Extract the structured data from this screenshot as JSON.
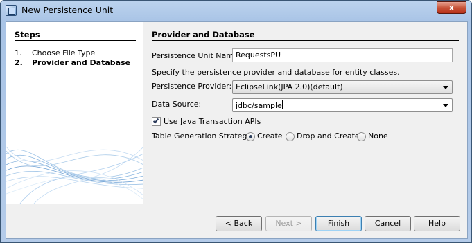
{
  "window": {
    "title": "New Persistence Unit",
    "close_glyph": "x"
  },
  "steps": {
    "title": "Steps",
    "items": [
      {
        "num": "1.",
        "label": "Choose File Type",
        "active": false
      },
      {
        "num": "2.",
        "label": "Provider and Database",
        "active": true
      }
    ]
  },
  "main": {
    "title": "Provider and Database",
    "unit_name_label": "Persistence Unit Name:",
    "unit_name_value": "RequestsPU",
    "description": "Specify the persistence provider and database for entity classes.",
    "provider_label": "Persistence Provider:",
    "provider_value": "EclipseLink(JPA 2.0)(default)",
    "datasource_label": "Data Source:",
    "datasource_value": "jdbc/sample",
    "jta_label": "Use Java Transaction APIs",
    "jta_checked": true,
    "strategy_label": "Table Generation Strategy:",
    "strategy_options": [
      "Create",
      "Drop and Create",
      "None"
    ],
    "strategy_selected": "Create"
  },
  "buttons": {
    "back": "< Back",
    "next": "Next >",
    "finish": "Finish",
    "cancel": "Cancel",
    "help": "Help"
  },
  "icons": {
    "app": "persistence-unit-icon",
    "close": "close-icon",
    "dropdown": "chevron-down-icon"
  }
}
